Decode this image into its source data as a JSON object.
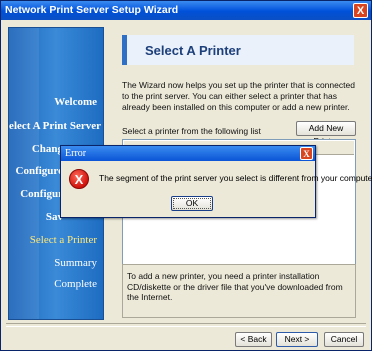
{
  "window": {
    "title": "Network Print Server Setup Wizard",
    "close_glyph": "X"
  },
  "sidebar": {
    "items": [
      {
        "label": "Welcome"
      },
      {
        "label": "Select A Print Server"
      },
      {
        "label": "Chang"
      },
      {
        "label": "Configure"
      },
      {
        "label": "Configur"
      },
      {
        "label": "Sav"
      },
      {
        "label": "Select a Printer"
      },
      {
        "label": "Summary"
      },
      {
        "label": "Complete"
      }
    ]
  },
  "main": {
    "heading": "Select A Printer",
    "intro": "The Wizard now helps you set up the printer that is connected to the print server. You can either select a printer that has already been installed on this computer or add a new printer.",
    "select_label": "Select a printer from the following list",
    "add_printer_label": "Add New Printer",
    "help_text": "To add a new printer, you need a printer installation CD/diskette or the driver file that you've downloaded from the Internet."
  },
  "footer": {
    "back_label": "< Back",
    "next_label": "Next >",
    "cancel_label": "Cancel"
  },
  "error_dialog": {
    "title": "Error",
    "message": "The segment of the print server you select is different from your computer.",
    "ok_label": "OK",
    "icon_glyph": "X"
  }
}
